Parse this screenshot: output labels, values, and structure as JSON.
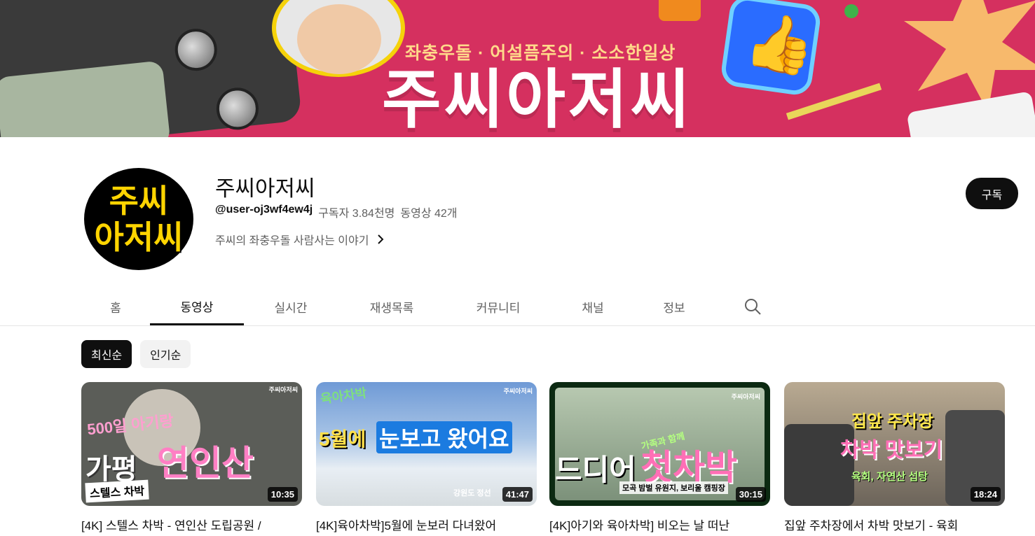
{
  "banner": {
    "subtitle": "좌충우돌 · 어설픔주의 · 소소한일상",
    "title": "주씨아저씨"
  },
  "channel": {
    "avatar_line1": "주씨",
    "avatar_line2": "아저씨",
    "name": "주씨아저씨",
    "handle": "@user-oj3wf4ew4j",
    "subscribers": "구독자 3.84천명",
    "videos": "동영상 42개",
    "description": "주씨의 좌충우돌 사람사는 이야기",
    "subscribe_label": "구독"
  },
  "tabs": [
    {
      "label": "홈",
      "active": false
    },
    {
      "label": "동영상",
      "active": true
    },
    {
      "label": "실시간",
      "active": false
    },
    {
      "label": "재생목록",
      "active": false
    },
    {
      "label": "커뮤니티",
      "active": false
    },
    {
      "label": "채널",
      "active": false
    },
    {
      "label": "정보",
      "active": false
    }
  ],
  "search_icon": "search-icon",
  "chips": [
    {
      "label": "최신순",
      "active": true
    },
    {
      "label": "인기순",
      "active": false
    }
  ],
  "videos": [
    {
      "title": "[4K] 스텔스 차박 - 연인산 도립공원 /",
      "duration": "10:35",
      "thumb_top": "500일 아기랑",
      "thumb_main1": "가평",
      "thumb_main2": "연인산",
      "thumb_bottom": "스텔스 차박",
      "watermark": "주씨아저씨",
      "bg": "#5b5d58"
    },
    {
      "title": "[4K]육아차박]5월에 눈보러 다녀왔어",
      "duration": "41:47",
      "thumb_top": "육아차박",
      "thumb_main1": "5월에",
      "thumb_main2": "눈보고 왔어요",
      "thumb_bottom": "강원도 정선",
      "watermark": "주씨아저씨",
      "bg": "#7ea9da"
    },
    {
      "title": "[4K]아기와 육아차박] 비오는 날 떠난",
      "duration": "30:15",
      "thumb_top": "가족과 함께",
      "thumb_main1": "드디어",
      "thumb_main2": "첫차박",
      "thumb_bottom": "모곡 밤벌 유원지, 보리울 캠핑장",
      "watermark": "주씨아저씨",
      "bg": "#6a7d6a"
    },
    {
      "title": "집앞 주차장에서 차박 맛보기 - 육회",
      "duration": "18:24",
      "thumb_top": "집앞 주차장",
      "thumb_main1": "차박 맛보기",
      "thumb_main2": "",
      "thumb_bottom": "육회, 자연산 섭탕",
      "watermark": "",
      "bg": "#8c8275"
    }
  ],
  "colors": {
    "banner_bg": "#d5305f",
    "accent_yellow": "#ffd400",
    "text_primary": "#0f0f0f",
    "text_secondary": "#606060"
  }
}
